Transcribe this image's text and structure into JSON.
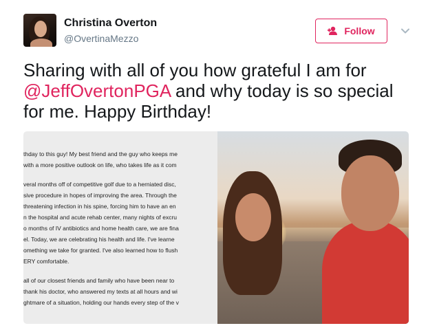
{
  "user": {
    "display_name": "Christina Overton",
    "handle": "@OvertinaMezzo"
  },
  "follow_button": {
    "label": "Follow"
  },
  "tweet": {
    "text_before": "Sharing with all of you how grateful I am for ",
    "mention": "@JeffOvertonPGA",
    "text_after": " and why today is so special for me. Happy Birthday!"
  },
  "media": {
    "letter_lines": [
      "thday to this guy! My best friend and the guy who keeps me",
      "with a more positive outlook on life, who takes life as it com",
      "veral months off of competitive golf due to a herniated disc,",
      "sive procedure in hopes of improving the area. Through the",
      "threatening infection in his spine, forcing him to have an en",
      "n the hospital and acute rehab center, many nights of excru",
      "o months of IV antibiotics and home health care, we are fina",
      "el.  Today, we are celebrating his health and life. I've learne",
      "omething we take for granted. I've also learned how to flush",
      "ERY comfortable.",
      "all of our closest friends and family who have been near to",
      "thank his doctor, who answered my texts at all hours and wi",
      "ghtmare of a situation, holding our hands every step of the v"
    ]
  },
  "colors": {
    "accent": "#e0245e",
    "secondary_text": "#657786",
    "primary_text": "#14171a"
  },
  "icons": {
    "follow": "add-user-icon",
    "more": "chevron-down-icon"
  }
}
